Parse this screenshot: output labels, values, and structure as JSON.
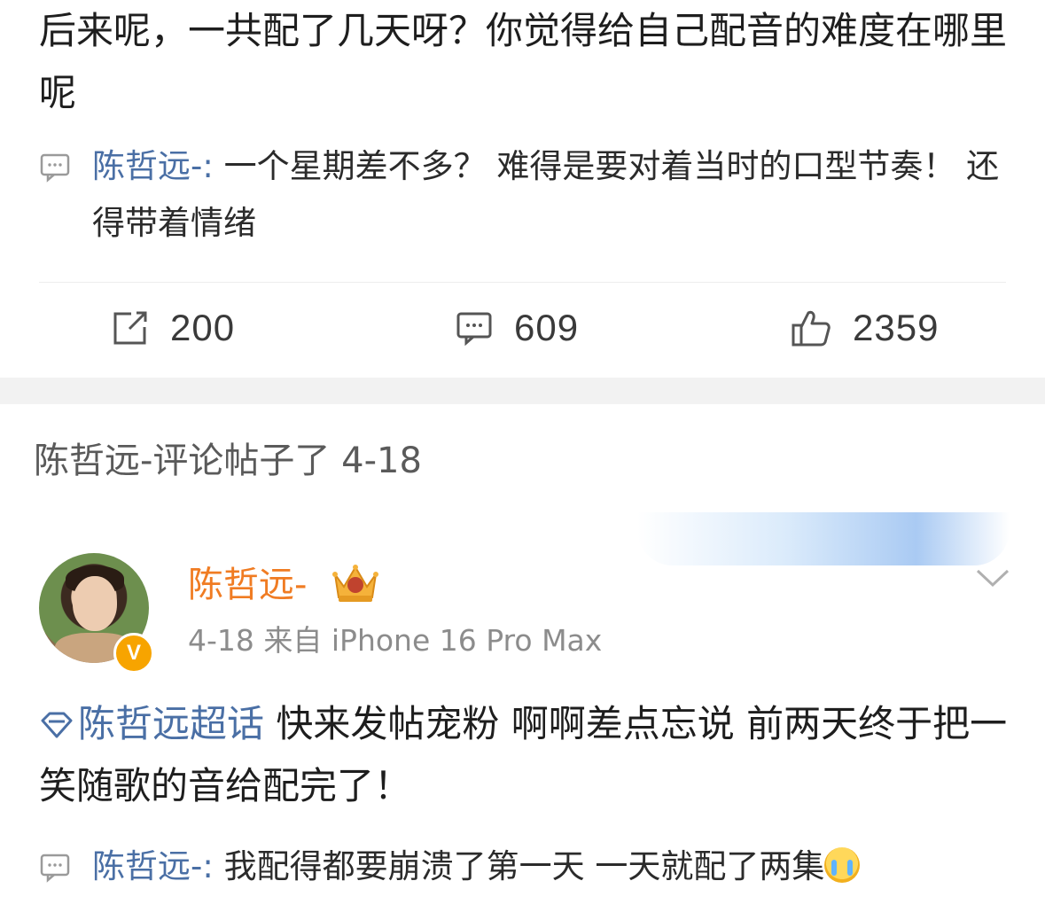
{
  "post": {
    "text": "后来呢，一共配了几天呀？你觉得给自己配音的难度在哪里呢"
  },
  "top_comment": {
    "author": "陈哲远-",
    "colon": ":",
    "text": " 一个星期差不多？  难得是要对着当时的口型节奏！ 还得带着情绪"
  },
  "actions": {
    "repost_count": "200",
    "comment_count": "609",
    "like_count": "2359"
  },
  "activity": {
    "header": "陈哲远-评论帖子了 4-18"
  },
  "card": {
    "username": "陈哲远-",
    "badge": "V",
    "meta": "4-18  来自 iPhone 16 Pro Max",
    "topic": "陈哲远超话",
    "body": " 快来发帖宠粉 啊啊差点忘说 前两天终于把一笑随歌的音给配完了！",
    "comment": {
      "author": "陈哲远-",
      "colon": ":",
      "text": " 我配得都要崩溃了第一天 一天就配了两集"
    }
  },
  "colors": {
    "link_blue": "#4a6fa5",
    "username_orange": "#f07c23",
    "vip_badge": "#f7a400"
  }
}
